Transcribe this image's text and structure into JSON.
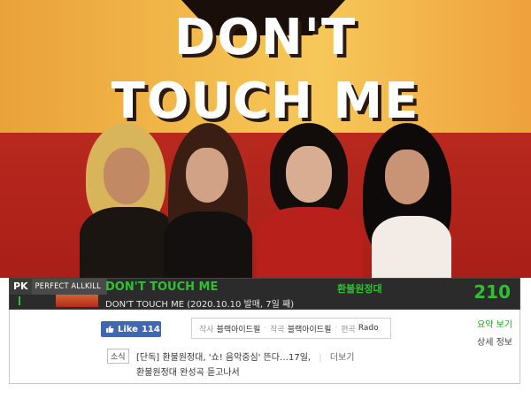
{
  "poster": {
    "title_line1": "DON'T",
    "title_line2": "TOUCH ME"
  },
  "song_bar": {
    "pk_label": "PK",
    "perfect_allkill_label": "PERFECT ALLKILL",
    "title": "DON'T TOUCH ME",
    "subtitle": "DON'T TOUCH ME (2020.10.10 발매, 7일 째)",
    "artist": "환불원정대",
    "score": "210",
    "accent_color": "#2ec22e"
  },
  "panel": {
    "like_label": "Like",
    "like_count": "114",
    "credits": {
      "lyrics_label": "작사",
      "lyrics_value": "블랙아이드필",
      "composer_label": "작곡",
      "composer_value": "블랙아이드필",
      "arranger_label": "편곡",
      "arranger_value": "Rado"
    },
    "summary_link": "요약 보기",
    "detail_link": "상세 정보",
    "news_tag": "소식",
    "news_headline1": "[단독] 환불원정대, '쇼! 음악중심' 뜬다…17일,",
    "news_more": "더보기",
    "news_headline2": "환불원정대 완성곡 듣고나서"
  }
}
